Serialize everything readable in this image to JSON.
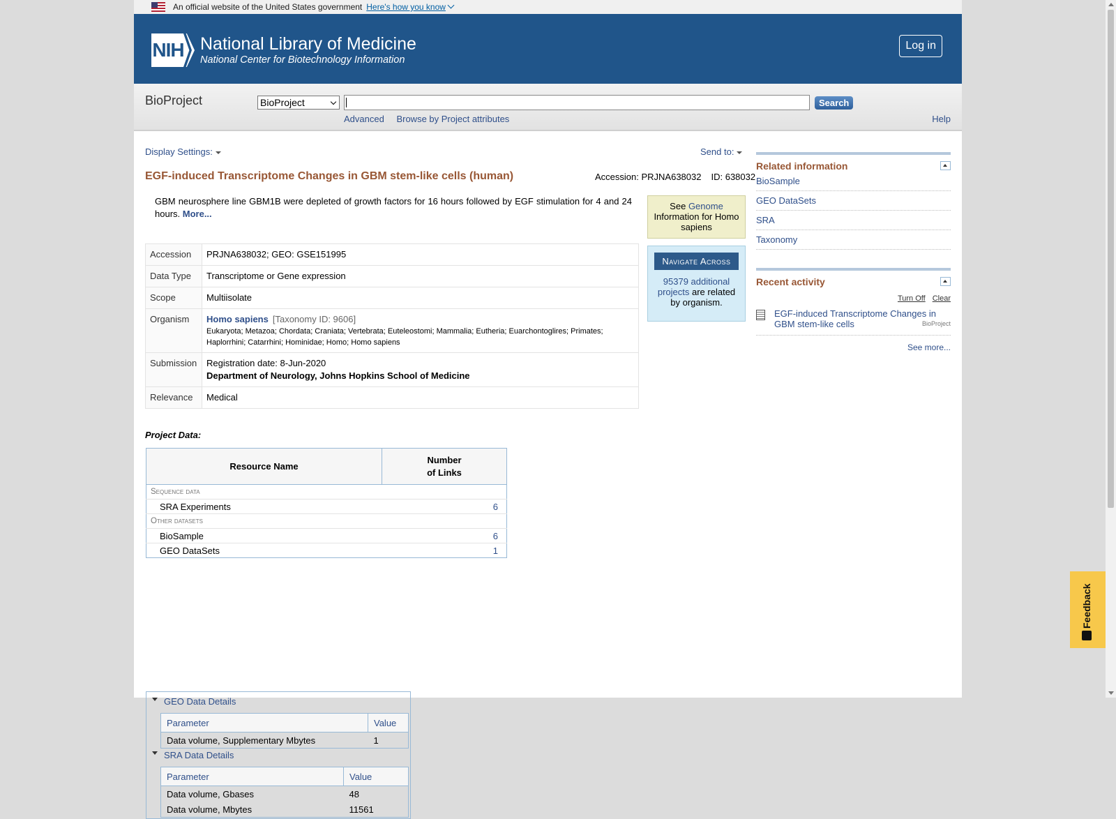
{
  "gov_banner": {
    "text": "An official website of the United States government",
    "link": "Here's how you know"
  },
  "header": {
    "logo_text": "NIH",
    "title": "National Library of Medicine",
    "subtitle": "National Center for Biotechnology Information",
    "login": "Log in"
  },
  "search": {
    "db_name": "BioProject",
    "db_selected": "BioProject",
    "query": "",
    "button": "Search",
    "advanced": "Advanced",
    "browse": "Browse by Project attributes",
    "help": "Help"
  },
  "toolbar": {
    "display_settings": "Display Settings:",
    "send_to": "Send to:"
  },
  "record": {
    "title": "EGF-induced Transcriptome Changes in GBM stem-like cells (human)",
    "accession_label": "Accession: PRJNA638032",
    "id_label": "ID: 638032",
    "description": "GBM neurosphere line GBM1B were depleted of growth factors for 16 hours followed by EGF stimulation for 4 and 24 hours.",
    "more": "More...",
    "rows": {
      "accession": {
        "label": "Accession",
        "value": "PRJNA638032; GEO: GSE151995"
      },
      "data_type": {
        "label": "Data Type",
        "value": "Transcriptome or Gene expression"
      },
      "scope": {
        "label": "Scope",
        "value": "Multiisolate"
      },
      "organism": {
        "label": "Organism",
        "name": "Homo sapiens",
        "taxonomy": "[Taxonomy ID: 9606]",
        "lineage": "Eukaryota; Metazoa; Chordata; Craniata; Vertebrata; Euteleostomi; Mammalia; Eutheria; Euarchontoglires; Primates; Haplorrhini; Catarrhini; Hominidae; Homo; Homo sapiens"
      },
      "submission": {
        "label": "Submission",
        "date": "Registration date: 8-Jun-2020",
        "org": "Department of Neurology, Johns Hopkins School of Medicine"
      },
      "relevance": {
        "label": "Relevance",
        "value": "Medical"
      }
    }
  },
  "genome_box": {
    "see": "See",
    "link": "Genome",
    "rest": "Information for Homo sapiens"
  },
  "navigate_box": {
    "head": "Navigate Across",
    "link": "95379 additional projects",
    "rest": "are related by organism."
  },
  "project_data": {
    "label": "Project Data:",
    "col_name": "Resource Name",
    "col_links_1": "Number",
    "col_links_2": "of Links",
    "groups": [
      {
        "category": "Sequence data",
        "items": [
          {
            "name": "SRA Experiments",
            "count": "6"
          }
        ]
      },
      {
        "category": "Other datasets",
        "items": [
          {
            "name": "BioSample",
            "count": "6"
          },
          {
            "name": "GEO DataSets",
            "count": "1"
          }
        ]
      }
    ]
  },
  "geo_details": {
    "title": "GEO Data Details",
    "col_param": "Parameter",
    "col_value": "Value",
    "rows": [
      {
        "param": "Data volume, Supplementary Mbytes",
        "value": "1"
      }
    ]
  },
  "sra_details": {
    "title": "SRA Data Details",
    "col_param": "Parameter",
    "col_value": "Value",
    "rows": [
      {
        "param": "Data volume, Gbases",
        "value": "48"
      },
      {
        "param": "Data volume, Mbytes",
        "value": "11561"
      }
    ]
  },
  "related": {
    "title": "Related information",
    "items": [
      "BioSample",
      "GEO DataSets",
      "SRA",
      "Taxonomy"
    ]
  },
  "recent": {
    "title": "Recent activity",
    "turn_off": "Turn Off",
    "clear": "Clear",
    "item_text": "EGF-induced Transcriptome Changes in GBM stem-like cells",
    "item_db": "BioProject",
    "see_more": "See more..."
  },
  "feedback": {
    "label": "Feedback"
  },
  "colors": {
    "header_bg": "#20558a",
    "title_color": "#985735",
    "link_color": "#2f4f8a",
    "genome_bg": "#f0efcb",
    "navigate_bg": "#d5ecf7",
    "feedback_bg": "#f7c84b"
  }
}
